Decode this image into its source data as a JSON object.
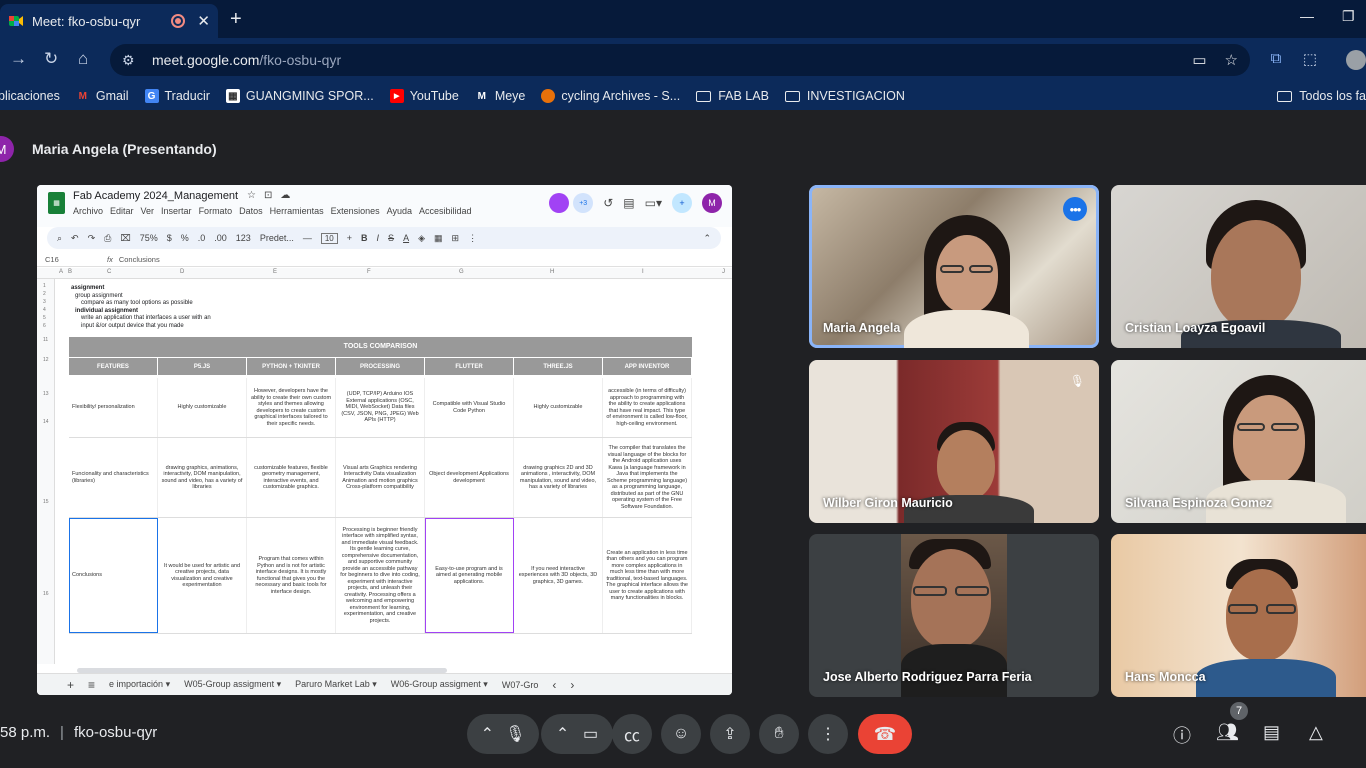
{
  "browser": {
    "tab_title": "Meet: fko-osbu-qyr",
    "url_host": "meet.google.com",
    "url_path": "/fko-osbu-qyr",
    "bookmarks": [
      "plicaciones",
      "Gmail",
      "Traducir",
      "GUANGMING SPOR...",
      "YouTube",
      "Meye",
      "cycling Archives - S...",
      "FAB LAB",
      "INVESTIGACION"
    ],
    "bookmarks_right": "Todos los fa"
  },
  "meet": {
    "presenter_initial": "M",
    "presenter_label": "Maria Angela (Presentando)",
    "time": "58 p.m.",
    "meeting_code": "fko-osbu-qyr",
    "participant_count": "7",
    "end_call_color": "#ea4335",
    "active_speaker_color": "#8ab4f8"
  },
  "sheet": {
    "title": "Fab Academy 2024_Management",
    "menu": [
      "Archivo",
      "Editar",
      "Ver",
      "Insertar",
      "Formato",
      "Datos",
      "Herramientas",
      "Extensiones",
      "Ayuda",
      "Accesibilidad"
    ],
    "zoom": "75%",
    "font": "Predet...",
    "font_size": "10",
    "cell_ref": "C16",
    "formula": "Conclusions",
    "collab_count": "+3",
    "user_initial": "M",
    "intro": {
      "line1": "assignment",
      "line2": "group assignment",
      "line3": "compare as many tool options as possible",
      "line4": "individual assignment",
      "line5": "write an application that interfaces a user with an",
      "line6": "input &/or output device that you made"
    },
    "table_title": "TOOLS COMPARISON",
    "headers": [
      "FEATURES",
      "P5.JS",
      "PYTHON + TKINTER",
      "PROCESSING",
      "FLUTTER",
      "THREE.JS",
      "APP INVENTOR"
    ],
    "rows": [
      [
        "Flexibility/ personalization",
        "Highly customizable",
        "However, developers have the ability to create their own custom styles and themes allowing developers to create custom graphical interfaces tailored to their specific needs.",
        "(UDP, TCP/IP) Arduino IOS External applications (OSC, MIDI, WebSocket) Data files (CSV, JSON, PNG, JPEG) Web APIs (HTTP)",
        "Compatible with Visual Studio Code Python",
        "Highly customizable",
        "accessible (in terms of difficulty) approach to programming with the ability to create applications that have real impact. This type of environment is called low-floor, high-ceiling environment."
      ],
      [
        "Funcionality and characteristics (libraries)",
        "drawing graphics, animations, interactivity, DOM manipulation, sound and video, has a variety of libraries",
        "customizable features, flexible geometry management, interactive events, and customizable graphics.",
        "Visual arts Graphics rendering Interactivity Data visualization Animation and motion graphics Cross-platform compatibility",
        "Object development Applications development",
        "drawing graphics 2D and 3D animations , interactivity, DOM manipulation, sound and video, has a variety of libraries",
        "The compiler that translates the visual language of the blocks for the Android application uses Kawa (a language framework in Java that implements the Scheme programming language) as a programming language, distributed as part of the GNU operating system of the Free Software Foundation."
      ],
      [
        "Conclusions",
        "It would be used for artistic and creative projects, data visualization and creative experimentation",
        "Program that comes within Python and is not for artistic interface designs. It is mostly functional that gives you the necessary and basic tools for interface design.",
        "Processing is beginner friendly interface with simplified syntax, and immediate visual feedback. Its gentle learning curve, comprehensive documentation, and supportive community provide an accessible pathway for beginners to dive into coding, experiment with interactive projects, and unleash their creativity. Processing offers a welcoming and empowering environment for learning, experimentation, and creative projects.",
        "Easy-to-use program and is aimed at generating mobile applications.",
        "If you need interactive experiences with 3D objects, 3D graphics, 3D games.",
        "Create an application in less time than others and you can program more complex applications in much less time than with more traditional, text-based languages. The graphical interface allows the user to create applications with many functionalities in blocks."
      ]
    ],
    "sheet_tabs": [
      "e importación",
      "W05-Group assigment",
      "Paruro Market Lab",
      "W06-Group assigment",
      "W07-Gro"
    ],
    "row_numbers": [
      "1",
      "2",
      "3",
      "4",
      "5",
      "6",
      "11",
      "12",
      "13",
      "14",
      "15",
      "16"
    ],
    "col_letters": [
      "A",
      "B",
      "C",
      "D",
      "E",
      "F",
      "G",
      "H",
      "I",
      "J"
    ]
  },
  "participants": [
    {
      "name": "Maria Angela"
    },
    {
      "name": "Cristian Loayza Egoavil"
    },
    {
      "name": "Wilber Giron Mauricio"
    },
    {
      "name": "Silvana Espinoza Gomez"
    },
    {
      "name": "Jose Alberto Rodriguez Parra Feria"
    },
    {
      "name": "Hans Moncca"
    }
  ]
}
